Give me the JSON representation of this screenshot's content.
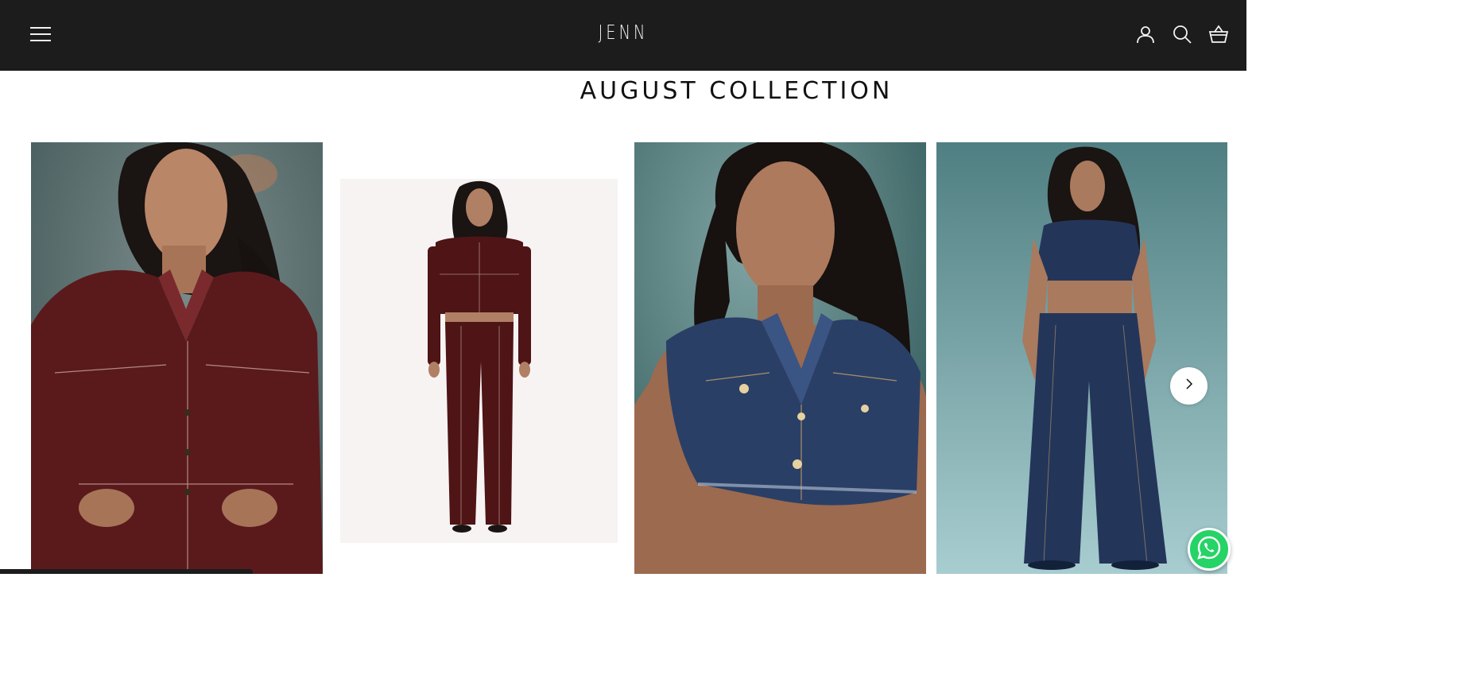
{
  "header": {
    "logo_text": "JENN",
    "menu_icon": "hamburger-menu-icon",
    "account_icon": "user-account-icon",
    "search_icon": "search-icon",
    "cart_icon": "shopping-basket-icon",
    "background": "#1c1c1c"
  },
  "collection": {
    "title": "AUGUST COLLECTION"
  },
  "gallery": {
    "slides": [
      {
        "outfit": "burgundy denim jacket set",
        "color": "#5a1a1c"
      },
      {
        "outfit": "burgundy denim jumpsuit",
        "color": "#4e1416"
      },
      {
        "outfit": "cropped blue denim vest",
        "color": "#2a3f66"
      },
      {
        "outfit": "blue denim vest and wide-leg jeans",
        "color": "#24355a"
      }
    ],
    "next_icon": "chevron-right-icon"
  },
  "whatsapp": {
    "icon": "whatsapp-icon",
    "color": "#25d366"
  }
}
